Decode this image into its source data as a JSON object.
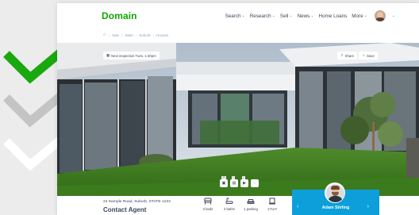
{
  "header": {
    "logo": "Domain",
    "nav": [
      {
        "label": "Search",
        "chevron": true
      },
      {
        "label": "Research",
        "chevron": true
      },
      {
        "label": "Sell",
        "chevron": true
      },
      {
        "label": "News",
        "chevron": true
      },
      {
        "label": "Home Loans",
        "chevron": false
      },
      {
        "label": "More",
        "chevron": true
      }
    ]
  },
  "breadcrumb": [
    "Sale",
    "State",
    "Suburb",
    "Houses"
  ],
  "hero": {
    "inspection": "Next inspection Tues, 1:30pm",
    "share": "Share",
    "save": "Save",
    "media": [
      {
        "icon": "photos-icon",
        "count": "20"
      },
      {
        "icon": "floorplan-icon",
        "count": "1"
      },
      {
        "icon": "video-icon",
        "count": "1"
      },
      {
        "icon": "3d-tour-icon",
        "count": ""
      }
    ]
  },
  "listing": {
    "address": "24 Sample Road, Suburb, STATE 1234",
    "price": "Contact Agent",
    "features": [
      {
        "icon": "bed-icon",
        "label": "3 beds"
      },
      {
        "icon": "bath-icon",
        "label": "2 baths"
      },
      {
        "icon": "car-icon",
        "label": "1 parking"
      },
      {
        "icon": "land-size-icon",
        "label": "171m²"
      }
    ]
  },
  "agent": {
    "name": "Adam Stirling"
  },
  "colors": {
    "brand": "#0ea800",
    "agent_bg": "#0d9fda",
    "text": "#3c475b",
    "check_green": "#1aa80f",
    "check_gray": "#c4c4c4"
  }
}
